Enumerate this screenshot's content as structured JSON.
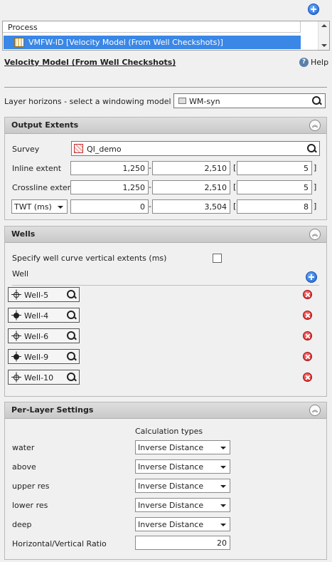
{
  "process_list": {
    "header": "Process",
    "selected_item": "VMFW-ID [Velocity Model (From Well Checkshots)]"
  },
  "form": {
    "title": "Velocity Model (From Well Checkshots)",
    "help_label": "Help",
    "layer_horizons_label": "Layer horizons - select a windowing model",
    "layer_horizons_value": "WM-syn"
  },
  "output_extents": {
    "title": "Output Extents",
    "survey_label": "Survey",
    "survey_value": "QI_demo",
    "inline_label": "Inline extent",
    "inline_from": "1,250",
    "inline_to": "2,510",
    "inline_step": "5",
    "crossline_label": "Crossline extent",
    "crossline_from": "1,250",
    "crossline_to": "2,510",
    "crossline_step": "5",
    "time_unit": "TWT (ms)",
    "time_from": "0",
    "time_to": "3,504",
    "time_step": "8",
    "dash": "-",
    "bracket_open": "[",
    "bracket_close": "]"
  },
  "wells": {
    "title": "Wells",
    "specify_label": "Specify well curve vertical extents (ms)",
    "specify_checked": false,
    "well_label": "Well",
    "items": [
      {
        "name": "Well-5",
        "icon": "well-open-icon"
      },
      {
        "name": "Well-4",
        "icon": "well-filled-icon"
      },
      {
        "name": "Well-6",
        "icon": "well-open-icon"
      },
      {
        "name": "Well-9",
        "icon": "well-filled-icon"
      },
      {
        "name": "Well-10",
        "icon": "well-open-icon"
      }
    ]
  },
  "per_layer": {
    "title": "Per-Layer Settings",
    "calc_header": "Calculation types",
    "layers": [
      {
        "name": "water",
        "value": "Inverse Distance"
      },
      {
        "name": "above",
        "value": "Inverse Distance"
      },
      {
        "name": "upper res",
        "value": "Inverse Distance"
      },
      {
        "name": "lower res",
        "value": "Inverse Distance"
      },
      {
        "name": "deep",
        "value": "Inverse Distance"
      }
    ],
    "ratio_label": "Horizontal/Vertical Ratio",
    "ratio_value": "20"
  },
  "colors": {
    "selection": "#3a87e6",
    "panel_header": "#cfcfcf",
    "add_blue": "#1a5fd0",
    "remove_red": "#d01818"
  }
}
